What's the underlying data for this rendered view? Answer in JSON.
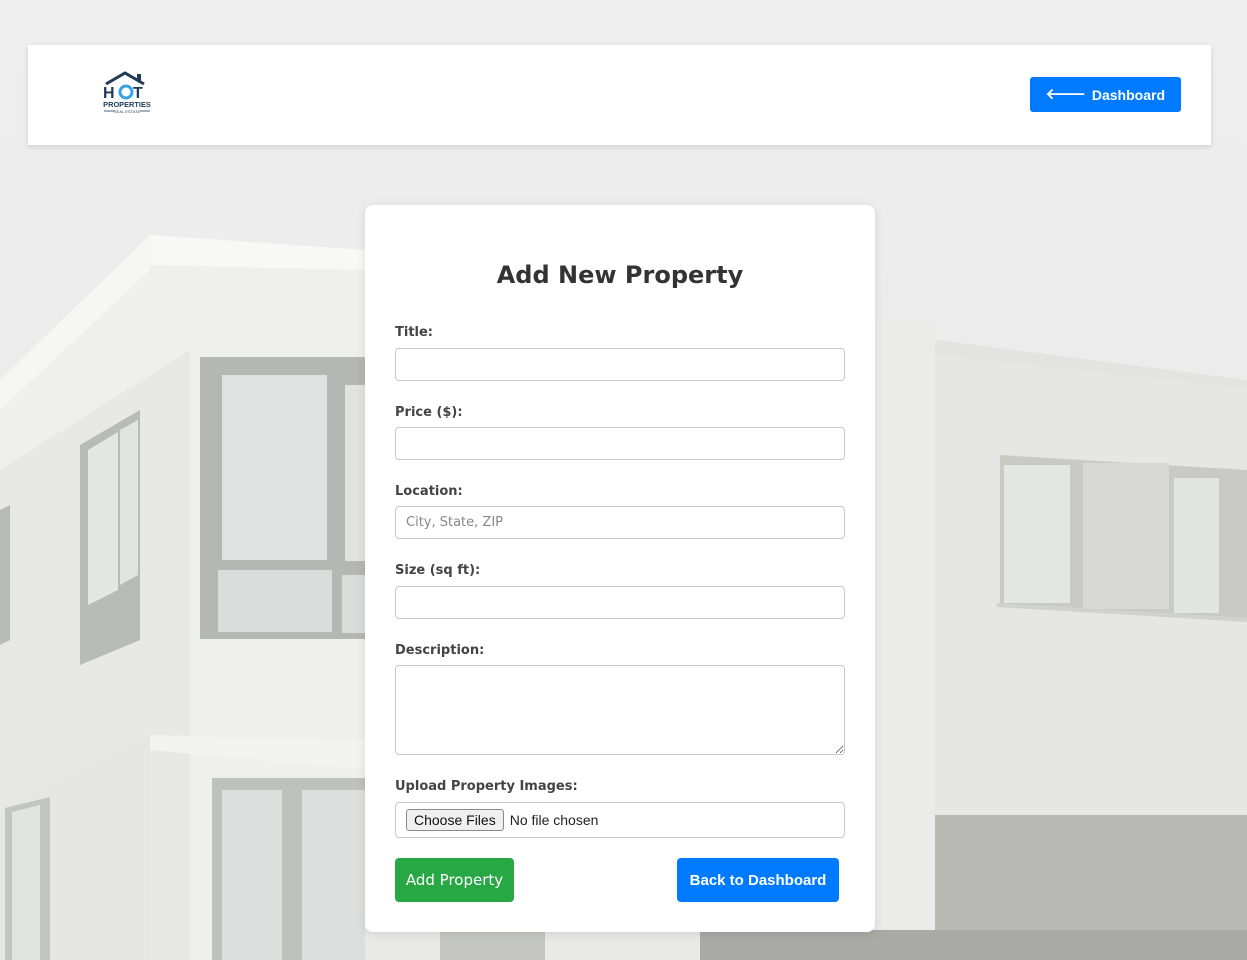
{
  "header": {
    "logo_top": "HOT",
    "logo_middle": "PROPERTIES",
    "logo_bottom": "REAL ESTATE",
    "dashboard_label": "Dashboard",
    "dashboard_icon": "arrow-left-icon"
  },
  "form": {
    "heading": "Add New Property",
    "fields": {
      "title": {
        "label": "Title:",
        "value": "",
        "placeholder": ""
      },
      "price": {
        "label": "Price ($):",
        "value": "",
        "placeholder": ""
      },
      "location": {
        "label": "Location:",
        "value": "",
        "placeholder": "City, State, ZIP"
      },
      "size": {
        "label": "Size (sq ft):",
        "value": "",
        "placeholder": ""
      },
      "description": {
        "label": "Description:",
        "value": ""
      },
      "images": {
        "label": "Upload Property Images:",
        "button_label": "Choose Files",
        "status": "No file chosen"
      }
    },
    "submit_label": "Add Property",
    "back_label": "Back to Dashboard"
  },
  "colors": {
    "primary": "#007bff",
    "success": "#28a745",
    "logo_dark": "#1f3b57",
    "logo_accent": "#3aa3e3"
  }
}
